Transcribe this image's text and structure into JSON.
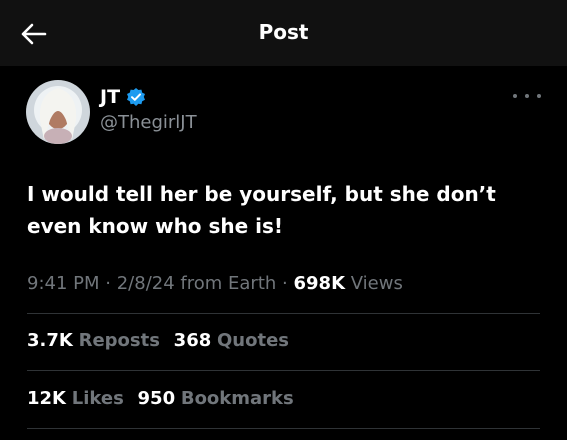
{
  "header": {
    "title": "Post",
    "back_icon": "arrow-left-icon"
  },
  "post": {
    "author": {
      "name": "JT",
      "handle": "@ThegirlJT",
      "verified_icon": "verified-badge-icon",
      "verified_color": "#1d9bf0"
    },
    "more_icon": "more-options-icon",
    "text": "I would tell her be yourself, but she don’t even know who she is!",
    "meta": {
      "time": "9:41 PM",
      "sep1": "·",
      "date": "2/8/24",
      "source": "from Earth",
      "sep2": "·",
      "views_count": "698K",
      "views_label": "Views"
    },
    "stats": {
      "reposts_count": "3.7K",
      "reposts_label": "Reposts",
      "quotes_count": "368",
      "quotes_label": "Quotes",
      "likes_count": "12K",
      "likes_label": "Likes",
      "bookmarks_count": "950",
      "bookmarks_label": "Bookmarks"
    }
  },
  "colors": {
    "background": "#000000",
    "header_bg": "#111111",
    "primary_text": "#ffffff",
    "secondary_text": "#71767b",
    "divider": "#2f3336",
    "accent": "#1d9bf0"
  }
}
